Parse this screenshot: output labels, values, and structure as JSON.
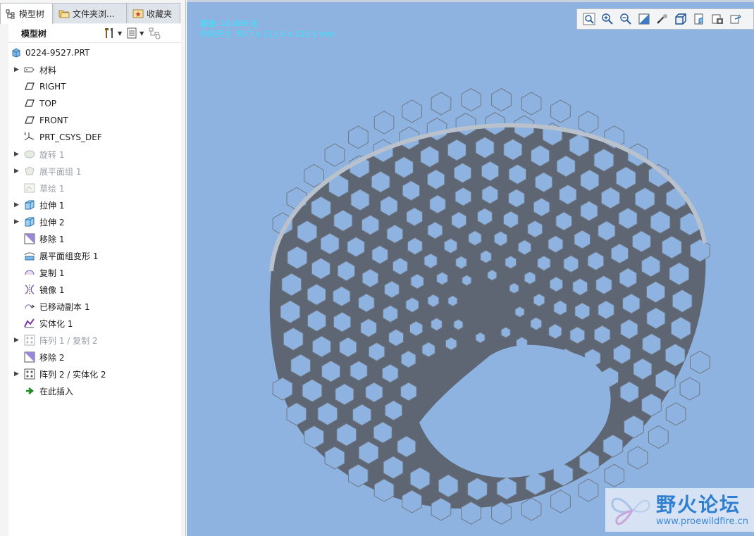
{
  "tabs": [
    {
      "label": "模型树",
      "icon": "tree-icon"
    },
    {
      "label": "文件夹浏...",
      "icon": "folder-icon"
    },
    {
      "label": "收藏夹",
      "icon": "favorites-icon"
    }
  ],
  "tree_header": {
    "title": "模型树"
  },
  "tree": {
    "root": "0224-9527.PRT",
    "items": [
      {
        "label": "材料",
        "icon": "material-icon",
        "expand": true,
        "dim": false
      },
      {
        "label": "RIGHT",
        "icon": "datum-plane-icon",
        "expand": false,
        "dim": false
      },
      {
        "label": "TOP",
        "icon": "datum-plane-icon",
        "expand": false,
        "dim": false
      },
      {
        "label": "FRONT",
        "icon": "datum-plane-icon",
        "expand": false,
        "dim": false
      },
      {
        "label": "PRT_CSYS_DEF",
        "icon": "csys-icon",
        "expand": false,
        "dim": false
      },
      {
        "label": "旋转 1",
        "icon": "revolve-icon",
        "expand": true,
        "dim": true
      },
      {
        "label": "展平面组 1",
        "icon": "flatten-quilt-icon",
        "expand": true,
        "dim": true
      },
      {
        "label": "草绘 1",
        "icon": "sketch-icon",
        "expand": false,
        "dim": true
      },
      {
        "label": "拉伸 1",
        "icon": "extrude-icon",
        "expand": true,
        "dim": false
      },
      {
        "label": "拉伸 2",
        "icon": "extrude-icon",
        "expand": true,
        "dim": false
      },
      {
        "label": "移除 1",
        "icon": "remove-icon",
        "expand": false,
        "dim": false
      },
      {
        "label": "展平面组变形 1",
        "icon": "flatten-deform-icon",
        "expand": false,
        "dim": false
      },
      {
        "label": "复制 1",
        "icon": "copy-icon",
        "expand": false,
        "dim": false
      },
      {
        "label": "镜像 1",
        "icon": "mirror-icon",
        "expand": false,
        "dim": false
      },
      {
        "label": "已移动副本 1",
        "icon": "moved-copy-icon",
        "expand": false,
        "dim": false
      },
      {
        "label": "实体化 1",
        "icon": "solidify-icon",
        "expand": false,
        "dim": false
      },
      {
        "label": "阵列 1 / 复制 2",
        "icon": "pattern-icon",
        "expand": true,
        "dim": true
      },
      {
        "label": "移除 2",
        "icon": "remove-icon",
        "expand": false,
        "dim": false
      },
      {
        "label": "阵列 2 / 实体化 2",
        "icon": "pattern-icon",
        "expand": true,
        "dim": false
      },
      {
        "label": "在此插入",
        "icon": "insert-here-arrow-icon",
        "expand": false,
        "dim": false
      }
    ]
  },
  "viewport": {
    "info_line1": "重量: 10.689 克",
    "info_line2": "外轮尺寸: 55.7 x 111.5 x 111.5 mm",
    "toolbar": [
      "refit-icon",
      "zoom-in-icon",
      "zoom-out-icon",
      "repaint-icon",
      "spin-center-icon",
      "display-style-icon",
      "saved-orientations-icon",
      "view-manager-icon",
      "perspective-icon"
    ],
    "background": "#8fb3e1"
  },
  "watermark": {
    "title": "野火论坛",
    "url": "www.proewildfire.cn"
  }
}
